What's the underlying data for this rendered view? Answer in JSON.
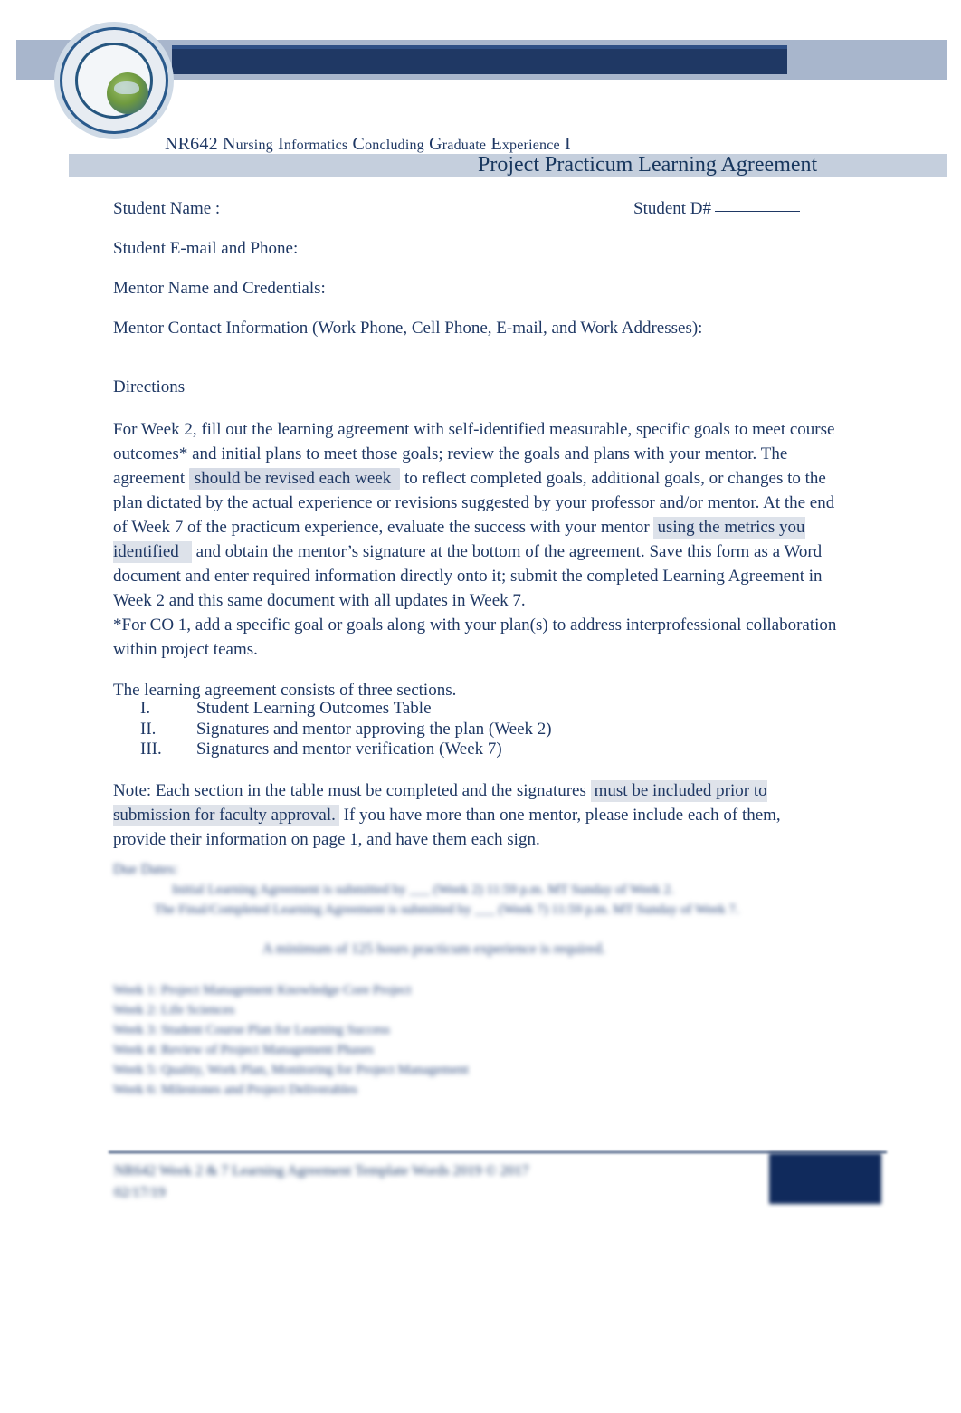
{
  "header": {
    "logo_name": "chamberlain-seal-logo",
    "band_label": ""
  },
  "course": {
    "prefix": "NR642 N",
    "smallcaps_1": "ursing",
    "word_2": "I",
    "smallcaps_2": "nformatics",
    "word_3": "C",
    "smallcaps_3": "oncluding",
    "word_4": "G",
    "smallcaps_4": "raduate",
    "word_5": "E",
    "smallcaps_5": "xperience",
    "suffix": "I",
    "full_line": "NR642 NURSING INFORMATICS CONCLUDING GRADUATE EXPERIENCE I"
  },
  "document": {
    "title": "Project Practicum Learning Agreement"
  },
  "fields": {
    "student_name": "Student Name    :",
    "student_d": "Student D#",
    "email_phone": "Student E-mail and Phone:",
    "mentor_name": "Mentor Name and Credentials:",
    "mentor_contact": "Mentor Contact Information (Work Phone, Cell Phone, E-mail, and Work Addresses):"
  },
  "directions": {
    "heading": "Directions",
    "p1_a": "For Week 2, fill out the learning agreement with self-identified measurable, specific goals to meet course outcomes* and initial plans to meet those goals; review the goals and plans with your mentor. The agreement ",
    "p1_hl1": "should be revised each week",
    "p1_b": " to reflect completed goals, additional goals, or changes to the plan dictated by the actual experience or revisions suggested by your professor and/or mentor. At the end of Week 7 of the practicum experience, evaluate the success with your mentor ",
    "p1_hl2": "using the metrics you identified",
    "p1_c": " and obtain the mentor’s signature at the bottom of the agreement. Save this form as a Word document and enter required information directly onto it; submit the completed Learning Agreement in Week 2 and this same document with all updates in Week 7.",
    "p1_d": "*For CO 1, add a specific goal or goals along with your plan(s) to address interprofessional collaboration within project teams."
  },
  "sections": {
    "intro": "The learning agreement consists of three sections.",
    "items": [
      {
        "numeral": "I.",
        "label": "Student Learning Outcomes Table"
      },
      {
        "numeral": "II.",
        "label": "Signatures and mentor approving the plan (Week 2)"
      },
      {
        "numeral": "III.",
        "label": "Signatures and mentor verification (Week 7)"
      }
    ]
  },
  "note": {
    "a": "Note: Each section in the table must be completed and the signatures ",
    "hl": "must be included prior to submission for faculty approval.",
    "b": "  If you have more than one mentor, please include each of them, provide their information on page 1, and have them each sign."
  },
  "blurred": {
    "heading": "Due Dates:",
    "line1": "Initial Learning Agreement is submitted by ___ (Week 2) 11:59 p.m. MT Sunday of Week 2.",
    "line2": "The Final/Completed Learning Agreement is submitted by ___ (Week 7) 11:59 p.m. MT Sunday of Week 7.",
    "center": "A minimum of 125 hours practicum experience is required.",
    "co1": "Week 1: Project Management Knowledge Core Project",
    "co2": "Week 2: Life Sciences",
    "co3": "Week 3: Student Course Plan for Learning Success",
    "co4": "Week 4: Review of Project Management Phases",
    "co5": "Week 5: Quality, Work Plan, Monitoring for Project Management",
    "co6": "Week 6: Milestones and Project Deliverables"
  },
  "footer": {
    "line1": "NR642  Week 2 & 7 Learning Agreement  Template Words 2019 © 2017",
    "line2": "02/17/19",
    "page_box": ""
  }
}
